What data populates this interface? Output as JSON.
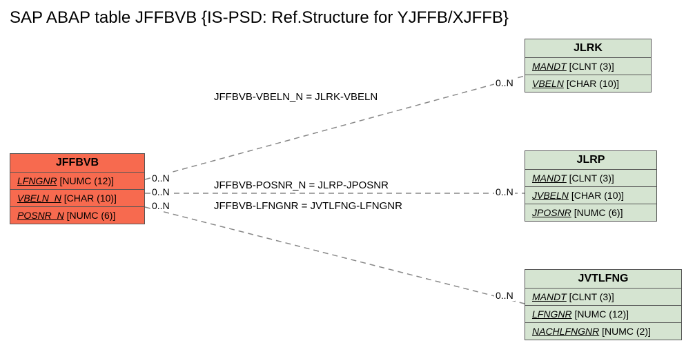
{
  "title": "SAP ABAP table JFFBVB {IS-PSD: Ref.Structure for YJFFB/XJFFB}",
  "main_entity": {
    "name": "JFFBVB",
    "fields": [
      {
        "fname": "LFNGNR",
        "ftype": "[NUMC (12)]"
      },
      {
        "fname": "VBELN_N",
        "ftype": "[CHAR (10)]"
      },
      {
        "fname": "POSNR_N",
        "ftype": "[NUMC (6)]"
      }
    ]
  },
  "entities": {
    "jlrk": {
      "name": "JLRK",
      "fields": [
        {
          "fname": "MANDT",
          "ftype": "[CLNT (3)]"
        },
        {
          "fname": "VBELN",
          "ftype": "[CHAR (10)]"
        }
      ]
    },
    "jlrp": {
      "name": "JLRP",
      "fields": [
        {
          "fname": "MANDT",
          "ftype": "[CLNT (3)]"
        },
        {
          "fname": "JVBELN",
          "ftype": "[CHAR (10)]"
        },
        {
          "fname": "JPOSNR",
          "ftype": "[NUMC (6)]"
        }
      ]
    },
    "jvtlfng": {
      "name": "JVTLFNG",
      "fields": [
        {
          "fname": "MANDT",
          "ftype": "[CLNT (3)]"
        },
        {
          "fname": "LFNGNR",
          "ftype": "[NUMC (12)]"
        },
        {
          "fname": "NACHLFNGNR",
          "ftype": "[NUMC (2)]"
        }
      ]
    }
  },
  "relations": {
    "r1": {
      "label": "JFFBVB-VBELN_N = JLRK-VBELN",
      "left_card": "0..N",
      "right_card": "0..N"
    },
    "r2": {
      "label": "JFFBVB-POSNR_N = JLRP-JPOSNR",
      "left_card": "0..N",
      "right_card": "0..N"
    },
    "r3": {
      "label": "JFFBVB-LFNGNR = JVTLFNG-LFNGNR",
      "left_card": "0..N",
      "right_card": "0..N"
    }
  }
}
